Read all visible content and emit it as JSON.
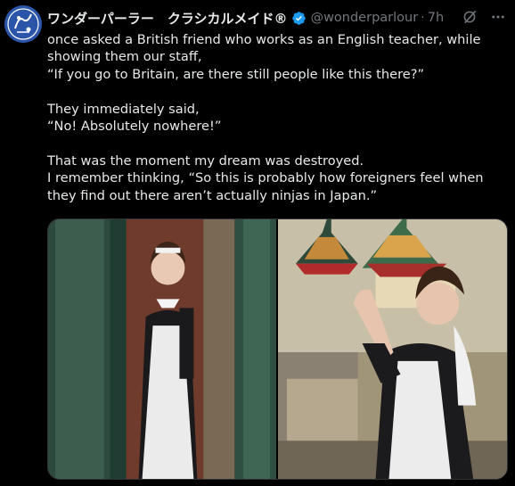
{
  "author": {
    "display_name": "ワンダーパーラー　クラシカルメイド®",
    "handle": "@wonderparlour",
    "separator": "·",
    "time": "7h",
    "avatar_text": "JoJ"
  },
  "icons": {
    "verified": "verified-badge-icon",
    "grok": "grok-icon",
    "more": "more-icon"
  },
  "tweet": {
    "line1": "once asked a British friend who works as an English teacher, while showing them our staff,",
    "line2": "“If you go to Britain, are there still people like this there?”",
    "line3": "They immediately said,",
    "line4": "“No! Absolutely nowhere!”",
    "line5": "That was the moment my dream was destroyed.",
    "line6": "I remember thinking, “So this is probably how foreigners feel when they find out there aren’t actually ninjas in Japan.”"
  },
  "colors": {
    "background": "#000000",
    "text": "#e7e9ea",
    "secondary": "#71767b",
    "verified": "#1d9bf0"
  }
}
